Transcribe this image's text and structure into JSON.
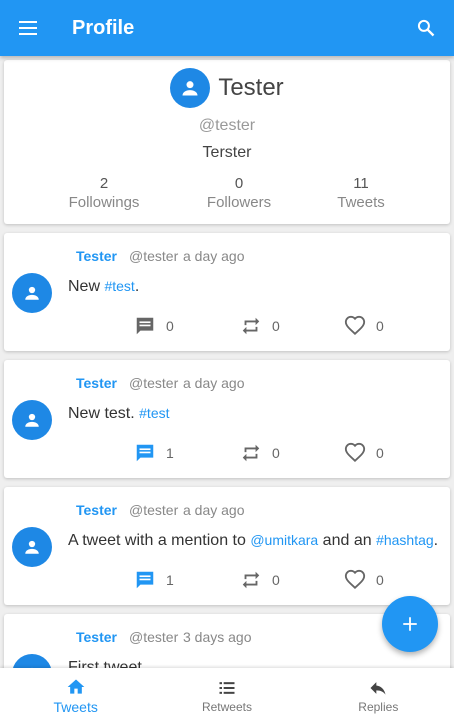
{
  "appbar": {
    "title": "Profile"
  },
  "profile": {
    "name": "Tester",
    "handle": "@tester",
    "bio": "Terster",
    "stats": [
      {
        "value": "2",
        "label": "Followings"
      },
      {
        "value": "0",
        "label": "Followers"
      },
      {
        "value": "11",
        "label": "Tweets"
      }
    ]
  },
  "tweets": [
    {
      "author": "Tester",
      "handle": "@tester",
      "time": "a day ago",
      "text_before": "New ",
      "link1": "#test",
      "text_middle": ".",
      "link2": "",
      "text_after": "",
      "replies": "0",
      "retweets": "0",
      "likes": "0"
    },
    {
      "author": "Tester",
      "handle": "@tester",
      "time": "a day ago",
      "text_before": "New test. ",
      "link1": "#test",
      "text_middle": "",
      "link2": "",
      "text_after": "",
      "replies": "1",
      "retweets": "0",
      "likes": "0"
    },
    {
      "author": "Tester",
      "handle": "@tester",
      "time": "a day ago",
      "text_before": "A tweet with a mention to ",
      "link1": "@umitkara",
      "text_middle": " and an ",
      "link2": "#hashtag",
      "text_after": ".",
      "replies": "1",
      "retweets": "0",
      "likes": "0"
    },
    {
      "author": "Tester",
      "handle": "@tester",
      "time": "3 days ago",
      "text_before": "First tweet",
      "link1": "",
      "text_middle": "",
      "link2": "",
      "text_after": "",
      "replies": "",
      "retweets": "",
      "likes": ""
    }
  ],
  "bottom_nav": [
    {
      "label": "Tweets",
      "icon": "home-icon",
      "active": true
    },
    {
      "label": "Retweets",
      "icon": "list-icon",
      "active": false
    },
    {
      "label": "Replies",
      "icon": "reply-icon",
      "active": false
    }
  ],
  "colors": {
    "primary": "#2196f3",
    "avatar": "#1e88e5"
  },
  "icons": {
    "menu": "menu-icon",
    "search": "search-icon",
    "fab": "add-icon",
    "reply": "comment-icon",
    "retweet": "retweet-icon",
    "like": "heart-icon"
  }
}
